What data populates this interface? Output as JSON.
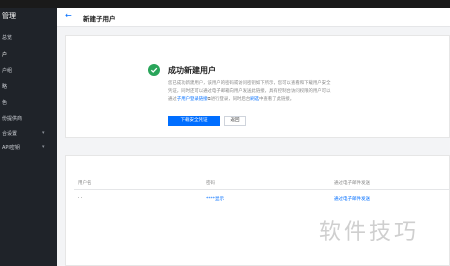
{
  "sidebar": {
    "title": "管理",
    "items": [
      {
        "label": "总览"
      },
      {
        "label": "户"
      },
      {
        "label": "户组"
      },
      {
        "label": "略"
      },
      {
        "label": "色"
      },
      {
        "label": "份提供商"
      },
      {
        "label": "合设置"
      },
      {
        "label": "API密钥"
      }
    ]
  },
  "header": {
    "back_icon": "arrow-left-icon",
    "title": "新建子用户"
  },
  "success": {
    "title": "成功新建用户",
    "desc_line1": "您已成功新建用户，该用户的密码或访问密钥如下所示，您可以查看和下载用户安全",
    "desc_line2": "凭证，同时还可以通过电子邮箱向用户发送此链接，具有控制台访问权限的用户可以",
    "desc_line3_pre": "通过",
    "desc_line3_link1": "子用户登录链接",
    "desc_line3_mid": "进行登录，同时后台",
    "desc_line3_link2": "刷选",
    "desc_line3_post": "中查看了此链接。",
    "download_button": "下载安全凭证",
    "return_button": "返回"
  },
  "table": {
    "headers": [
      "用户名",
      "密码",
      "通过电子邮件发送"
    ],
    "rows": [
      {
        "username": "· ·",
        "password": "****显示",
        "send": "通过电子邮件发送"
      }
    ]
  },
  "watermark": "软件技巧",
  "colors": {
    "accent": "#006eff",
    "success": "#29a55a",
    "sidebar_bg": "#1f2329"
  }
}
